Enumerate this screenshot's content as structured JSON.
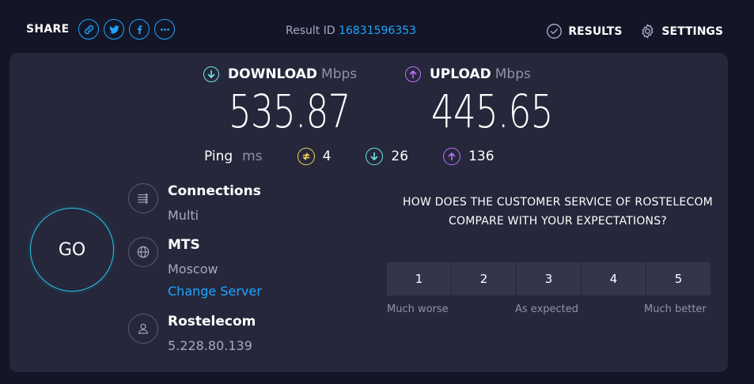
{
  "header": {
    "share_label": "SHARE",
    "share_buttons": [
      "link-icon",
      "twitter-icon",
      "facebook-icon",
      "more-icon"
    ],
    "result_id_label": "Result ID",
    "result_id": "16831596353",
    "results_label": "RESULTS",
    "settings_label": "SETTINGS"
  },
  "download": {
    "label": "DOWNLOAD",
    "unit": "Mbps",
    "value": "535.87"
  },
  "upload": {
    "label": "UPLOAD",
    "unit": "Mbps",
    "value": "445.65"
  },
  "ping": {
    "label": "Ping",
    "unit": "ms",
    "idle": "4",
    "download": "26",
    "upload": "136"
  },
  "go_label": "GO",
  "connections": {
    "title": "Connections",
    "value": "Multi"
  },
  "server": {
    "title": "MTS",
    "location": "Moscow",
    "change_label": "Change Server"
  },
  "provider": {
    "title": "Rostelecom",
    "ip": "5.228.80.139"
  },
  "survey": {
    "question": "HOW DOES THE CUSTOMER SERVICE OF ROSTELECOM COMPARE WITH YOUR EXPECTATIONS?",
    "options": [
      "1",
      "2",
      "3",
      "4",
      "5"
    ],
    "low_label": "Much worse",
    "mid_label": "As expected",
    "high_label": "Much better"
  },
  "colors": {
    "accent": "#1ea5ff",
    "download": "#6ee7ea",
    "upload": "#bf71ff",
    "jitter": "#f2d35b",
    "go_ring": "#22c8e6"
  }
}
